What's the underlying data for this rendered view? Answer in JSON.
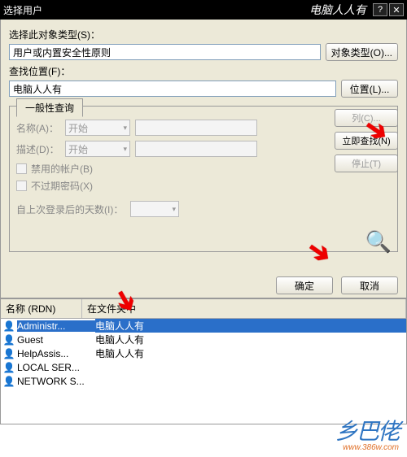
{
  "title": "选择用户",
  "brand": "电脑人人有",
  "objType": {
    "label": "选择此对象类型(S)：",
    "value": "用户或内置安全性原则",
    "button": "对象类型(O)..."
  },
  "location": {
    "label": "查找位置(F)：",
    "value": "电脑人人有",
    "button": "位置(L)..."
  },
  "tabs": {
    "label": "一般性查询"
  },
  "form": {
    "nameLabel": "名称(A)：",
    "nameCombo": "开始",
    "descLabel": "描述(D)：",
    "descCombo": "开始",
    "chkDisabled": "禁用的帐户(B)",
    "chkNoExpire": "不过期密码(X)",
    "daysLabel": "自上次登录后的天数(I)："
  },
  "rightBtns": {
    "col": "列(C)...",
    "findNow": "立即查找(N)",
    "stop": "停止(T)"
  },
  "okBtn": "确定",
  "cancelBtn": "取消",
  "listHeader": {
    "rdn": "名称 (RDN)",
    "folder": "在文件夹中"
  },
  "listRows": [
    {
      "name": "Administr...",
      "folder": "电脑人人有",
      "selected": true
    },
    {
      "name": "Guest",
      "folder": "电脑人人有",
      "selected": false
    },
    {
      "name": "HelpAssis...",
      "folder": "电脑人人有",
      "selected": false
    },
    {
      "name": "LOCAL SER...",
      "folder": "",
      "selected": false
    },
    {
      "name": "NETWORK S...",
      "folder": "",
      "selected": false
    }
  ],
  "watermark": {
    "main": "乡巴佬",
    "url": "www.386w.com"
  }
}
